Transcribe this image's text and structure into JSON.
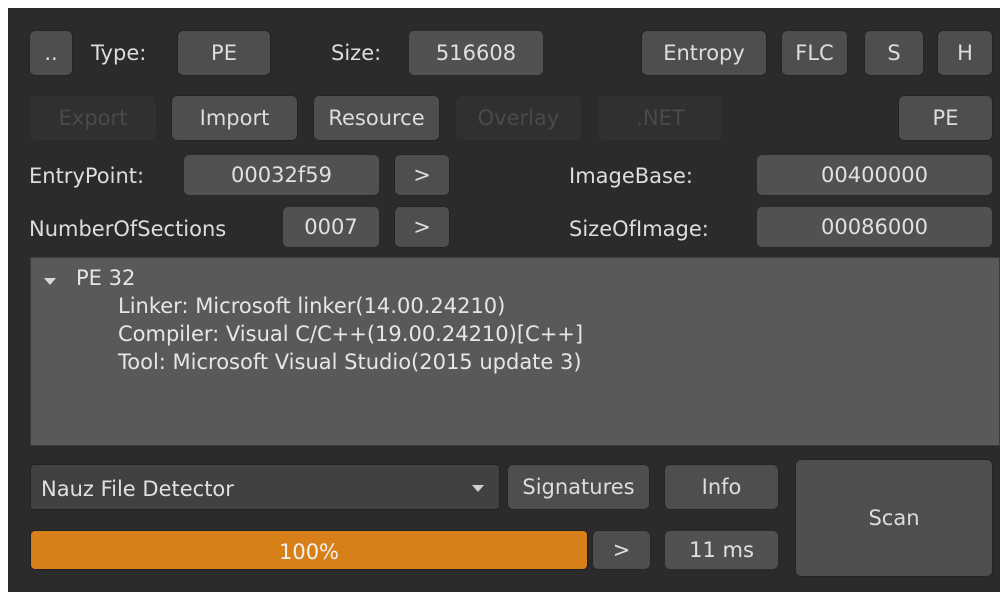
{
  "toolbar": {
    "dotdot_label": "..",
    "type_label": "Type:",
    "type_value": "PE",
    "size_label": "Size:",
    "size_value": "516608",
    "entropy_label": "Entropy",
    "flc_label": "FLC",
    "s_label": "S",
    "h_label": "H"
  },
  "sections": {
    "export_label": "Export",
    "import_label": "Import",
    "resource_label": "Resource",
    "overlay_label": "Overlay",
    "net_label": ".NET",
    "pe_label": "PE"
  },
  "header_fields": {
    "entrypoint_label": "EntryPoint:",
    "entrypoint_value": "00032f59",
    "imagebase_label": "ImageBase:",
    "imagebase_value": "00400000",
    "numsections_label": "NumberOfSections",
    "numsections_value": "0007",
    "sizeofimage_label": "SizeOfImage:",
    "sizeofimage_value": "00086000",
    "goto_label": ">"
  },
  "results": {
    "root": "PE 32",
    "items": [
      "Linker: Microsoft linker(14.00.24210)",
      "Compiler: Visual C/C++(19.00.24210)[C++]",
      "Tool: Microsoft Visual Studio(2015 update 3)"
    ]
  },
  "bottom": {
    "detector_selected": "Nauz File Detector",
    "signatures_label": "Signatures",
    "info_label": "Info",
    "scan_label": "Scan",
    "progress_text": "100%",
    "progress_value": 1.0,
    "progress_color": "#d7801a",
    "next_label": ">",
    "time_value": "11 ms"
  }
}
